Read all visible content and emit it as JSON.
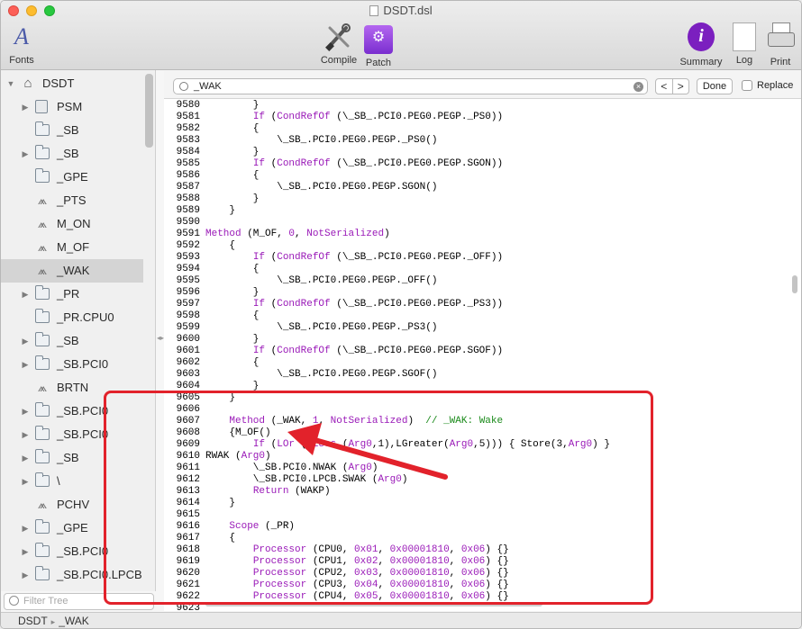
{
  "window": {
    "title": "DSDT.dsl"
  },
  "toolbar": {
    "fonts": "Fonts",
    "compile": "Compile",
    "patch": "Patch",
    "summary": "Summary",
    "log": "Log",
    "print": "Print"
  },
  "sidebar": {
    "items": [
      {
        "label": "DSDT",
        "icon": "home",
        "disclosure": "open",
        "level": 0
      },
      {
        "label": "PSM",
        "icon": "device",
        "disclosure": "closed",
        "level": 1
      },
      {
        "label": "_SB",
        "icon": "folder",
        "disclosure": "none",
        "level": 1
      },
      {
        "label": "_SB",
        "icon": "folder",
        "disclosure": "closed",
        "level": 1
      },
      {
        "label": "_GPE",
        "icon": "folder",
        "disclosure": "none",
        "level": 1
      },
      {
        "label": "_PTS",
        "icon": "method",
        "disclosure": "none",
        "level": 1
      },
      {
        "label": "M_ON",
        "icon": "method",
        "disclosure": "none",
        "level": 1
      },
      {
        "label": "M_OF",
        "icon": "method",
        "disclosure": "none",
        "level": 1
      },
      {
        "label": "_WAK",
        "icon": "method",
        "disclosure": "none",
        "level": 1,
        "selected": true
      },
      {
        "label": "_PR",
        "icon": "folder",
        "disclosure": "closed",
        "level": 1
      },
      {
        "label": "_PR.CPU0",
        "icon": "folder",
        "disclosure": "none",
        "level": 1
      },
      {
        "label": "_SB",
        "icon": "folder",
        "disclosure": "closed",
        "level": 1
      },
      {
        "label": "_SB.PCI0",
        "icon": "folder",
        "disclosure": "closed",
        "level": 1
      },
      {
        "label": "BRTN",
        "icon": "method",
        "disclosure": "none",
        "level": 1
      },
      {
        "label": "_SB.PCI0",
        "icon": "folder",
        "disclosure": "closed",
        "level": 1
      },
      {
        "label": "_SB.PCI0",
        "icon": "folder",
        "disclosure": "closed",
        "level": 1
      },
      {
        "label": "_SB",
        "icon": "folder",
        "disclosure": "closed",
        "level": 1
      },
      {
        "label": "\\",
        "icon": "folder",
        "disclosure": "closed",
        "level": 1
      },
      {
        "label": "PCHV",
        "icon": "method",
        "disclosure": "none",
        "level": 1
      },
      {
        "label": "_GPE",
        "icon": "folder",
        "disclosure": "closed",
        "level": 1
      },
      {
        "label": "_SB.PCI0",
        "icon": "folder",
        "disclosure": "closed",
        "level": 1
      },
      {
        "label": "_SB.PCI0.LPCB",
        "icon": "folder",
        "disclosure": "closed",
        "level": 1
      }
    ],
    "filter_placeholder": "Filter Tree"
  },
  "search": {
    "value": "_WAK",
    "done_label": "Done",
    "replace_label": "Replace",
    "prev_label": "<",
    "next_label": ">"
  },
  "code_lines": [
    {
      "n": "9580",
      "t": [
        [
          "        }",
          ""
        ]
      ]
    },
    {
      "n": "9581",
      "t": [
        [
          "        ",
          ""
        ],
        [
          "If",
          "kw"
        ],
        [
          " (",
          ""
        ],
        [
          "CondRefOf",
          "kw"
        ],
        [
          " (\\_SB_.PCI0.PEG0.PEGP._PS0))",
          ""
        ]
      ]
    },
    {
      "n": "9582",
      "t": [
        [
          "        {",
          ""
        ]
      ]
    },
    {
      "n": "9583",
      "t": [
        [
          "            \\_SB_.PCI0.PEG0.PEGP._PS0()",
          ""
        ]
      ]
    },
    {
      "n": "9584",
      "t": [
        [
          "        }",
          ""
        ]
      ]
    },
    {
      "n": "9585",
      "t": [
        [
          "        ",
          ""
        ],
        [
          "If",
          "kw"
        ],
        [
          " (",
          ""
        ],
        [
          "CondRefOf",
          "kw"
        ],
        [
          " (\\_SB_.PCI0.PEG0.PEGP.SGON))",
          ""
        ]
      ]
    },
    {
      "n": "9586",
      "t": [
        [
          "        {",
          ""
        ]
      ]
    },
    {
      "n": "9587",
      "t": [
        [
          "            \\_SB_.PCI0.PEG0.PEGP.SGON()",
          ""
        ]
      ]
    },
    {
      "n": "9588",
      "t": [
        [
          "        }",
          ""
        ]
      ]
    },
    {
      "n": "9589",
      "t": [
        [
          "    }",
          ""
        ]
      ]
    },
    {
      "n": "9590",
      "t": [
        [
          "",
          ""
        ]
      ]
    },
    {
      "n": "9591",
      "t": [
        [
          "",
          ""
        ],
        [
          "Method",
          "kw"
        ],
        [
          " (M_OF, ",
          ""
        ],
        [
          "0",
          "kw"
        ],
        [
          ", ",
          ""
        ],
        [
          "NotSerialized",
          "kw"
        ],
        [
          ")",
          ""
        ]
      ]
    },
    {
      "n": "9592",
      "t": [
        [
          "    {",
          ""
        ]
      ]
    },
    {
      "n": "9593",
      "t": [
        [
          "        ",
          ""
        ],
        [
          "If",
          "kw"
        ],
        [
          " (",
          ""
        ],
        [
          "CondRefOf",
          "kw"
        ],
        [
          " (\\_SB_.PCI0.PEG0.PEGP._OFF))",
          ""
        ]
      ]
    },
    {
      "n": "9594",
      "t": [
        [
          "        {",
          ""
        ]
      ]
    },
    {
      "n": "9595",
      "t": [
        [
          "            \\_SB_.PCI0.PEG0.PEGP._OFF()",
          ""
        ]
      ]
    },
    {
      "n": "9596",
      "t": [
        [
          "        }",
          ""
        ]
      ]
    },
    {
      "n": "9597",
      "t": [
        [
          "        ",
          ""
        ],
        [
          "If",
          "kw"
        ],
        [
          " (",
          ""
        ],
        [
          "CondRefOf",
          "kw"
        ],
        [
          " (\\_SB_.PCI0.PEG0.PEGP._PS3))",
          ""
        ]
      ]
    },
    {
      "n": "9598",
      "t": [
        [
          "        {",
          ""
        ]
      ]
    },
    {
      "n": "9599",
      "t": [
        [
          "            \\_SB_.PCI0.PEG0.PEGP._PS3()",
          ""
        ]
      ]
    },
    {
      "n": "9600",
      "t": [
        [
          "        }",
          ""
        ]
      ]
    },
    {
      "n": "9601",
      "t": [
        [
          "        ",
          ""
        ],
        [
          "If",
          "kw"
        ],
        [
          " (",
          ""
        ],
        [
          "CondRefOf",
          "kw"
        ],
        [
          " (\\_SB_.PCI0.PEG0.PEGP.SGOF))",
          ""
        ]
      ]
    },
    {
      "n": "9602",
      "t": [
        [
          "        {",
          ""
        ]
      ]
    },
    {
      "n": "9603",
      "t": [
        [
          "            \\_SB_.PCI0.PEG0.PEGP.SGOF()",
          ""
        ]
      ]
    },
    {
      "n": "9604",
      "t": [
        [
          "        }",
          ""
        ]
      ]
    },
    {
      "n": "9605",
      "t": [
        [
          "    }",
          ""
        ]
      ]
    },
    {
      "n": "9606",
      "t": [
        [
          "",
          ""
        ]
      ]
    },
    {
      "n": "9607",
      "t": [
        [
          "    ",
          ""
        ],
        [
          "Method",
          "kw"
        ],
        [
          " (_WAK, ",
          ""
        ],
        [
          "1",
          "kw"
        ],
        [
          ", ",
          ""
        ],
        [
          "NotSerialized",
          "kw"
        ],
        [
          ")  ",
          ""
        ],
        [
          "// _WAK: Wake",
          "cm"
        ]
      ]
    },
    {
      "n": "9608",
      "t": [
        [
          "    {M_OF()",
          ""
        ]
      ]
    },
    {
      "n": "9609",
      "t": [
        [
          "        ",
          ""
        ],
        [
          "If",
          "kw"
        ],
        [
          " (",
          ""
        ],
        [
          "LOr",
          "kw"
        ],
        [
          " (",
          ""
        ],
        [
          "LLess",
          "kw"
        ],
        [
          " (",
          ""
        ],
        [
          "Arg0",
          "kw"
        ],
        [
          ",1),LGreater(",
          ""
        ],
        [
          "Arg0",
          "kw"
        ],
        [
          ",5))) { Store(3,",
          ""
        ],
        [
          "Arg0",
          "kw"
        ],
        [
          ") }",
          ""
        ]
      ]
    },
    {
      "n": "9610",
      "t": [
        [
          "RWAK (",
          ""
        ],
        [
          "Arg0",
          "kw"
        ],
        [
          ")",
          ""
        ]
      ]
    },
    {
      "n": "9611",
      "t": [
        [
          "        \\_SB.PCI0.NWAK (",
          ""
        ],
        [
          "Arg0",
          "kw"
        ],
        [
          ")",
          ""
        ]
      ]
    },
    {
      "n": "9612",
      "t": [
        [
          "        \\_SB.PCI0.LPCB.SWAK (",
          ""
        ],
        [
          "Arg0",
          "kw"
        ],
        [
          ")",
          ""
        ]
      ]
    },
    {
      "n": "9613",
      "t": [
        [
          "        ",
          ""
        ],
        [
          "Return",
          "kw"
        ],
        [
          " (WAKP)",
          ""
        ]
      ]
    },
    {
      "n": "9614",
      "t": [
        [
          "    }",
          ""
        ]
      ]
    },
    {
      "n": "9615",
      "t": [
        [
          "",
          ""
        ]
      ]
    },
    {
      "n": "9616",
      "t": [
        [
          "    ",
          ""
        ],
        [
          "Scope",
          "kw"
        ],
        [
          " (_PR)",
          ""
        ]
      ]
    },
    {
      "n": "9617",
      "t": [
        [
          "    {",
          ""
        ]
      ]
    },
    {
      "n": "9618",
      "t": [
        [
          "        ",
          ""
        ],
        [
          "Processor",
          "kw"
        ],
        [
          " (CPU0, ",
          ""
        ],
        [
          "0x01",
          "kw"
        ],
        [
          ", ",
          ""
        ],
        [
          "0x00001810",
          "kw"
        ],
        [
          ", ",
          ""
        ],
        [
          "0x06",
          "kw"
        ],
        [
          ") {}",
          ""
        ]
      ]
    },
    {
      "n": "9619",
      "t": [
        [
          "        ",
          ""
        ],
        [
          "Processor",
          "kw"
        ],
        [
          " (CPU1, ",
          ""
        ],
        [
          "0x02",
          "kw"
        ],
        [
          ", ",
          ""
        ],
        [
          "0x00001810",
          "kw"
        ],
        [
          ", ",
          ""
        ],
        [
          "0x06",
          "kw"
        ],
        [
          ") {}",
          ""
        ]
      ]
    },
    {
      "n": "9620",
      "t": [
        [
          "        ",
          ""
        ],
        [
          "Processor",
          "kw"
        ],
        [
          " (CPU2, ",
          ""
        ],
        [
          "0x03",
          "kw"
        ],
        [
          ", ",
          ""
        ],
        [
          "0x00001810",
          "kw"
        ],
        [
          ", ",
          ""
        ],
        [
          "0x06",
          "kw"
        ],
        [
          ") {}",
          ""
        ]
      ]
    },
    {
      "n": "9621",
      "t": [
        [
          "        ",
          ""
        ],
        [
          "Processor",
          "kw"
        ],
        [
          " (CPU3, ",
          ""
        ],
        [
          "0x04",
          "kw"
        ],
        [
          ", ",
          ""
        ],
        [
          "0x00001810",
          "kw"
        ],
        [
          ", ",
          ""
        ],
        [
          "0x06",
          "kw"
        ],
        [
          ") {}",
          ""
        ]
      ]
    },
    {
      "n": "9622",
      "t": [
        [
          "        ",
          ""
        ],
        [
          "Processor",
          "kw"
        ],
        [
          " (CPU4, ",
          ""
        ],
        [
          "0x05",
          "kw"
        ],
        [
          ", ",
          ""
        ],
        [
          "0x00001810",
          "kw"
        ],
        [
          ", ",
          ""
        ],
        [
          "0x06",
          "kw"
        ],
        [
          ") {}",
          ""
        ]
      ]
    },
    {
      "n": "9623",
      "t": [
        [
          "",
          ""
        ]
      ]
    }
  ],
  "statusbar": {
    "root": "DSDT",
    "current": "_WAK"
  },
  "colors": {
    "keyword": "#9a1ab8",
    "comment": "#1a8a1a",
    "annotation": "#e2222b"
  }
}
